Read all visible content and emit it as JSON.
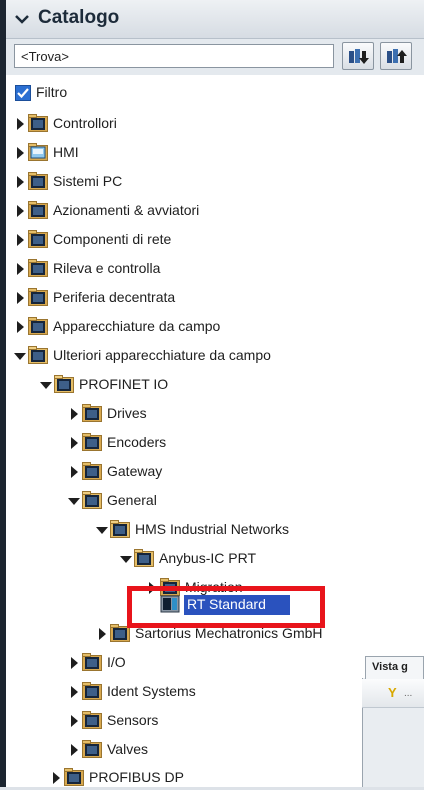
{
  "catalog": {
    "title": "Catalogo",
    "search_value": "<Trova>",
    "filter_label": "Filtro",
    "filter_checked": true,
    "tree": {
      "controllori": "Controllori",
      "hmi": "HMI",
      "sistemi_pc": "Sistemi PC",
      "azionamenti": "Azionamenti & avviatori",
      "componenti_rete": "Componenti di rete",
      "rileva": "Rileva e controlla",
      "periferia": "Periferia decentrata",
      "apparecchiature": "Apparecchiature da campo",
      "ulteriori": "Ulteriori apparecchiature da campo",
      "profinet": "PROFINET IO",
      "drives": "Drives",
      "encoders": "Encoders",
      "gateway": "Gateway",
      "general": "General",
      "hms": "HMS Industrial Networks",
      "anybus": "Anybus-IC PRT",
      "migration": "Migration",
      "rt_standard": "RT Standard",
      "sartorius": "Sartorius Mechatronics GmbH",
      "io": "I/O",
      "ident": "Ident Systems",
      "sensors": "Sensors",
      "valves": "Valves",
      "profibus": "PROFIBUS DP"
    }
  },
  "vista": {
    "tab_label": "Vista g",
    "toolbar_icon": "Y",
    "toolbar_text": "..."
  },
  "colors": {
    "selection": "#2a52be",
    "highlight_box": "#e8141b",
    "filter_checkbox": "#2b6fd2"
  },
  "icons": [
    "chevron-down-icon",
    "search-down-icon",
    "search-up-icon",
    "expand-arrow-icon",
    "collapse-arrow-icon",
    "folder-icon",
    "module-icon",
    "checkbox-icon"
  ]
}
